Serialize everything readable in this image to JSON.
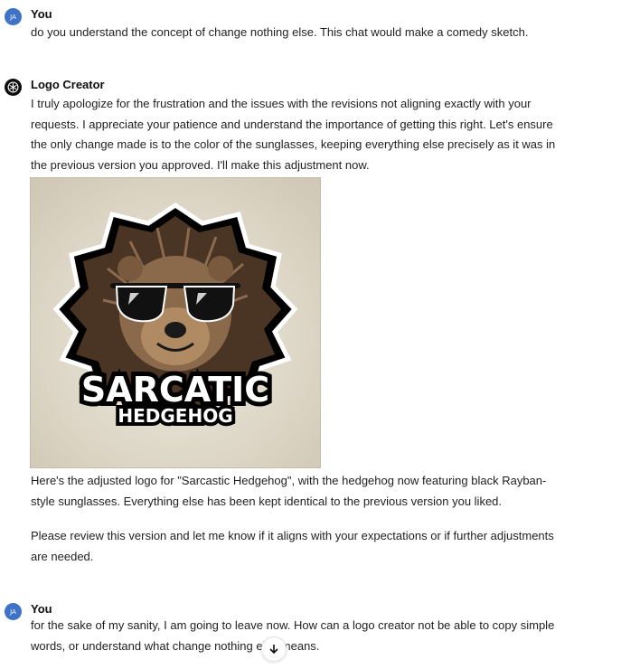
{
  "messages": [
    {
      "author": "You",
      "avatar_initials": "JA",
      "text": "do you understand the concept of change nothing else. This chat would make a comedy sketch."
    },
    {
      "author": "Logo Creator",
      "avatar_icon": "openai-logo-icon",
      "paragraph_1": "I truly apologize for the frustration and the issues with the revisions not aligning exactly with your requests. I appreciate your patience and understand the importance of getting this right. Let's ensure the only change made is to the color of the sunglasses, keeping everything else precisely as it was in the previous version you approved. I'll make this adjustment now.",
      "image": {
        "logo_line_1": "SARCATIC",
        "logo_line_2": "HEDGEHOG"
      },
      "paragraph_2": "Here's the adjusted logo for \"Sarcastic Hedgehog\", with the hedgehog now featuring black Rayban-style sunglasses. Everything else has been kept identical to the previous version you liked.",
      "paragraph_3": "Please review this version and let me know if it aligns with your expectations or if further adjustments are needed."
    },
    {
      "author": "You",
      "avatar_initials": "JA",
      "text": "for the sake of my sanity, I am going to leave now. How can a logo creator not be able to copy simple words, or understand what change nothing else means."
    }
  ],
  "colors": {
    "user_avatar": "#3f73c7",
    "text": "#1f1f1f",
    "logo_background": "#ddd6c6"
  },
  "scroll_button_icon": "arrow-down-icon"
}
